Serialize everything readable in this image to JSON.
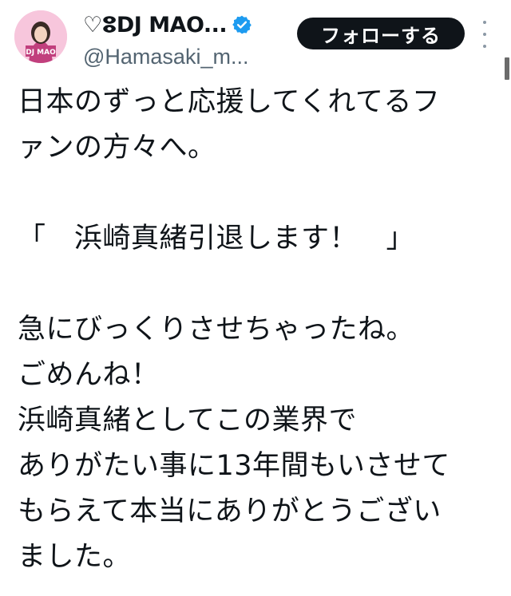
{
  "user": {
    "display_name": "♡ⵓDJ MAO...",
    "handle": "@Hamasaki_m...",
    "avatar_text": "DJ MAO",
    "verified": true
  },
  "actions": {
    "follow_label": "フォローする",
    "more_icon": "more-vertical-icon"
  },
  "tweet": {
    "lines": [
      "日本のずっと応援してくれてるフ",
      "ァンの方々へ。",
      "",
      "「　浜崎真緒引退します！　」",
      "",
      "急にびっくりさせちゃったね。",
      "ごめんね！",
      "浜崎真緒としてこの業界で",
      "ありがたい事に13年間もいさせて",
      "もらえて本当にありがとうござい",
      "ました。"
    ]
  },
  "colors": {
    "text": "#0f1419",
    "handle": "#536471",
    "button_bg": "#0f1419",
    "verified": "#1d9bf0",
    "avatar_bg": "#f7c6dc"
  }
}
